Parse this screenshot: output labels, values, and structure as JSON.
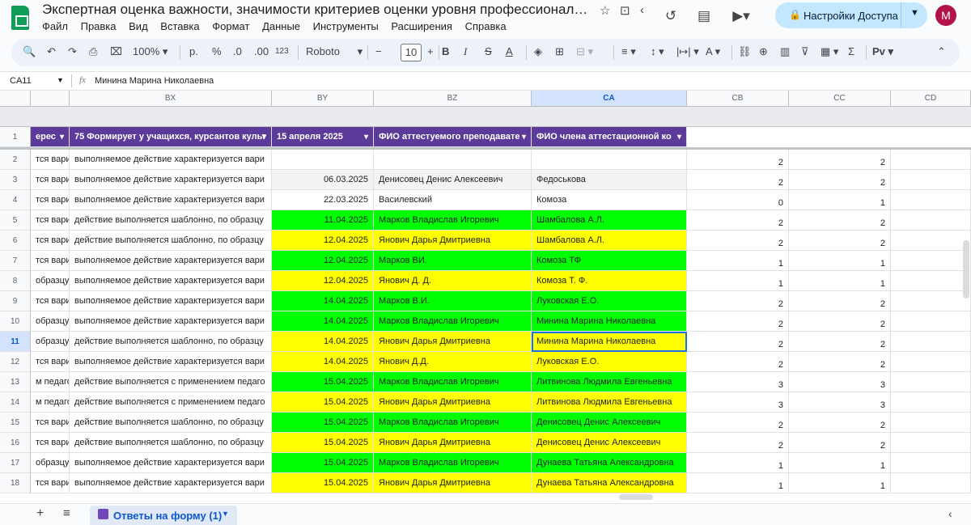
{
  "app": {
    "title": "Экспертная оценка важности, значимости критериев  оценки уровня профессионального мас…",
    "menu": [
      "Файл",
      "Правка",
      "Вид",
      "Вставка",
      "Формат",
      "Данные",
      "Инструменты",
      "Расширения",
      "Справка"
    ],
    "share_label": "Настройки Доступа",
    "avatar_letter": "М"
  },
  "toolbar": {
    "zoom": "100%",
    "currency": "р.",
    "percent": "%",
    "dec_dec": ".0",
    "dec_inc": ".00",
    "number_format": "123",
    "font": "Roboto",
    "font_size": "10",
    "minus": "−",
    "plus": "+",
    "bold": "B",
    "italic": "I",
    "strike": "S",
    "text_color": "A",
    "sigma": "Σ",
    "script": "Рv"
  },
  "formula": {
    "cell_ref": "CA11",
    "fx": "fx",
    "value": "Минина Марина Николаевна"
  },
  "columns": [
    "BX",
    "BY",
    "BZ",
    "CA",
    "CB",
    "CC",
    "CD"
  ],
  "header_cells": [
    "ерес",
    "75 Формирует у учащихся, курсантов культ",
    "15 апреля 2025",
    "ФИО аттестуемого преподавате",
    "ФИО члена аттестационной ко"
  ],
  "header_row_num": "1",
  "rows": [
    {
      "n": "2",
      "a": "тся вари",
      "b": "выполняемое действие характеризуется вари",
      "d": "",
      "p": "",
      "m": "",
      "cb": "2",
      "cc": "2",
      "color": "white"
    },
    {
      "n": "3",
      "a": "тся вари",
      "b": "выполняемое действие характеризуется вари",
      "d": "06.03.2025",
      "p": "Денисовец Денис Алексеевич",
      "m": "Федоськова",
      "cb": "2",
      "cc": "2",
      "color": "gray"
    },
    {
      "n": "4",
      "a": "тся вари",
      "b": "выполняемое действие характеризуется вари",
      "d": "22.03.2025",
      "p": "Василевский",
      "m": "Комоза",
      "cb": "0",
      "cc": "1",
      "color": "white"
    },
    {
      "n": "5",
      "a": "тся вари",
      "b": "действие выполняется шаблонно, по образцу",
      "d": "11.04.2025",
      "p": "Марков Владислав Игоревич",
      "m": "Шамбалова А.Л.",
      "cb": "2",
      "cc": "2",
      "color": "green"
    },
    {
      "n": "6",
      "a": "тся вари",
      "b": "действие выполняется шаблонно, по образцу",
      "d": "12.04.2025",
      "p": "Янович Дарья Дмитриевна",
      "m": "Шамбалова А.Л.",
      "cb": "2",
      "cc": "2",
      "color": "yellow"
    },
    {
      "n": "7",
      "a": "тся вари",
      "b": "выполняемое действие характеризуется вари",
      "d": "12.04.2025",
      "p": "Марков ВИ.",
      "m": "Комоза ТФ",
      "cb": "1",
      "cc": "1",
      "color": "green"
    },
    {
      "n": "8",
      "a": "образцу",
      "b": "выполняемое действие характеризуется вари",
      "d": "12.04.2025",
      "p": "Янович Д. Д.",
      "m": "Комоза Т. Ф.",
      "cb": "1",
      "cc": "1",
      "color": "yellow"
    },
    {
      "n": "9",
      "a": "тся вари",
      "b": "выполняемое действие характеризуется вари",
      "d": "14.04.2025",
      "p": "Марков В.И.",
      "m": "Луковская Е.О.",
      "cb": "2",
      "cc": "2",
      "color": "green"
    },
    {
      "n": "10",
      "a": "образцу",
      "b": "выполняемое действие характеризуется вари",
      "d": "14.04.2025",
      "p": "Марков Владислав Игоревич",
      "m": "Минина Марина Николаевна",
      "cb": "2",
      "cc": "2",
      "color": "green"
    },
    {
      "n": "11",
      "a": "образцу",
      "b": "действие выполняется шаблонно, по образцу",
      "d": "14.04.2025",
      "p": "Янович Дарья Дмитриевна",
      "m": "Минина Марина Николаевна",
      "cb": "2",
      "cc": "2",
      "color": "yellow"
    },
    {
      "n": "12",
      "a": "тся вари",
      "b": "выполняемое действие характеризуется вари",
      "d": "14.04.2025",
      "p": "Янович Д.Д.",
      "m": "Луковская Е.О.",
      "cb": "2",
      "cc": "2",
      "color": "yellow"
    },
    {
      "n": "13",
      "a": "м педаго",
      "b": "действие выполняется с применением педаго",
      "d": "15.04.2025",
      "p": "Марков Владислав Игоревич",
      "m": "Литвинова Людмила Евгеньевна",
      "cb": "3",
      "cc": "3",
      "color": "green"
    },
    {
      "n": "14",
      "a": "м педаго",
      "b": "действие выполняется с применением педаго",
      "d": "15.04.2025",
      "p": "Янович Дарья Дмитриевна",
      "m": "Литвинова Людмила Евгеньевна",
      "cb": "3",
      "cc": "3",
      "color": "yellow"
    },
    {
      "n": "15",
      "a": "тся вари",
      "b": "действие выполняется шаблонно, по образцу",
      "d": "15.04.2025",
      "p": "Марков Владислав Игоревич",
      "m": "Денисовец Денис Алексеевич",
      "cb": "2",
      "cc": "2",
      "color": "green"
    },
    {
      "n": "16",
      "a": "тся вари",
      "b": "действие выполняется шаблонно, по образцу",
      "d": "15.04.2025",
      "p": "Янович Дарья Дмитриевна",
      "m": "Денисовец Денис Алексеевич",
      "cb": "2",
      "cc": "2",
      "color": "yellow"
    },
    {
      "n": "17",
      "a": "образцу",
      "b": "выполняемое действие характеризуется вари",
      "d": "15.04.2025",
      "p": "Марков Владислав Игоревич",
      "m": "Дунаева Татьяна Александровна",
      "cb": "1",
      "cc": "1",
      "color": "green"
    },
    {
      "n": "18",
      "a": "тся вари",
      "b": "выполняемое действие характеризуется вари",
      "d": "15.04.2025",
      "p": "Янович Дарья Дмитриевна",
      "m": "Дунаева Татьяна Александровна",
      "cb": "1",
      "cc": "1",
      "color": "yellow"
    }
  ],
  "selected_row": "11",
  "colors": {
    "green": "#00ff00",
    "yellow": "#ffff00",
    "header_purple": "#5b3a99",
    "selection": "#1a73e8"
  },
  "sheet_tab": {
    "label": "Ответы на форму (1)"
  }
}
